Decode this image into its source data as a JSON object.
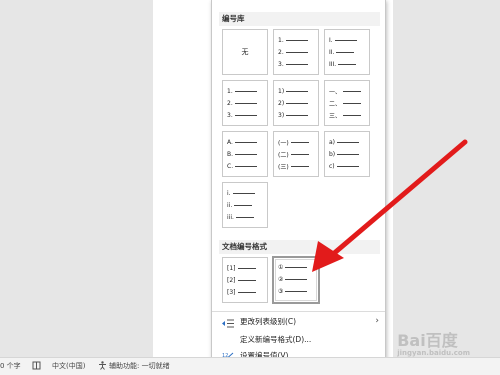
{
  "library": {
    "heading": "编号库",
    "none_label": "无",
    "formats": [
      [
        "1.",
        "2.",
        "3."
      ],
      [
        "I.",
        "II.",
        "III."
      ],
      [
        "1.",
        "2.",
        "3."
      ],
      [
        "1)",
        "2)",
        "3)"
      ],
      [
        "一、",
        "二、",
        "三、"
      ],
      [
        "A.",
        "B.",
        "C."
      ],
      [
        "(一)",
        "(二)",
        "(三)"
      ],
      [
        "a)",
        "b)",
        "c)"
      ],
      [
        "i.",
        "ii.",
        "iii."
      ]
    ]
  },
  "document": {
    "heading": "文档编号格式",
    "formats": [
      [
        "[1]",
        "[2]",
        "[3]"
      ],
      [
        "①",
        "②",
        "③"
      ]
    ]
  },
  "menu_items": [
    {
      "label": "更改列表级别(C)",
      "icon": "indent-level-icon",
      "has_submenu": true
    },
    {
      "label": "定义新编号格式(D)...",
      "icon": "",
      "has_submenu": false
    },
    {
      "label": "设置编号值(V)...",
      "icon": "numbering-value-icon",
      "has_submenu": false
    }
  ],
  "status_bar": {
    "word_count": "0 个字",
    "language": "中文(中国)",
    "accessibility": "辅助功能: 一切就绪"
  },
  "watermark": {
    "text": "Bai百度",
    "subtext": "jingyan.baidu.com"
  },
  "colors": {
    "arrow": "#e21b1b"
  }
}
